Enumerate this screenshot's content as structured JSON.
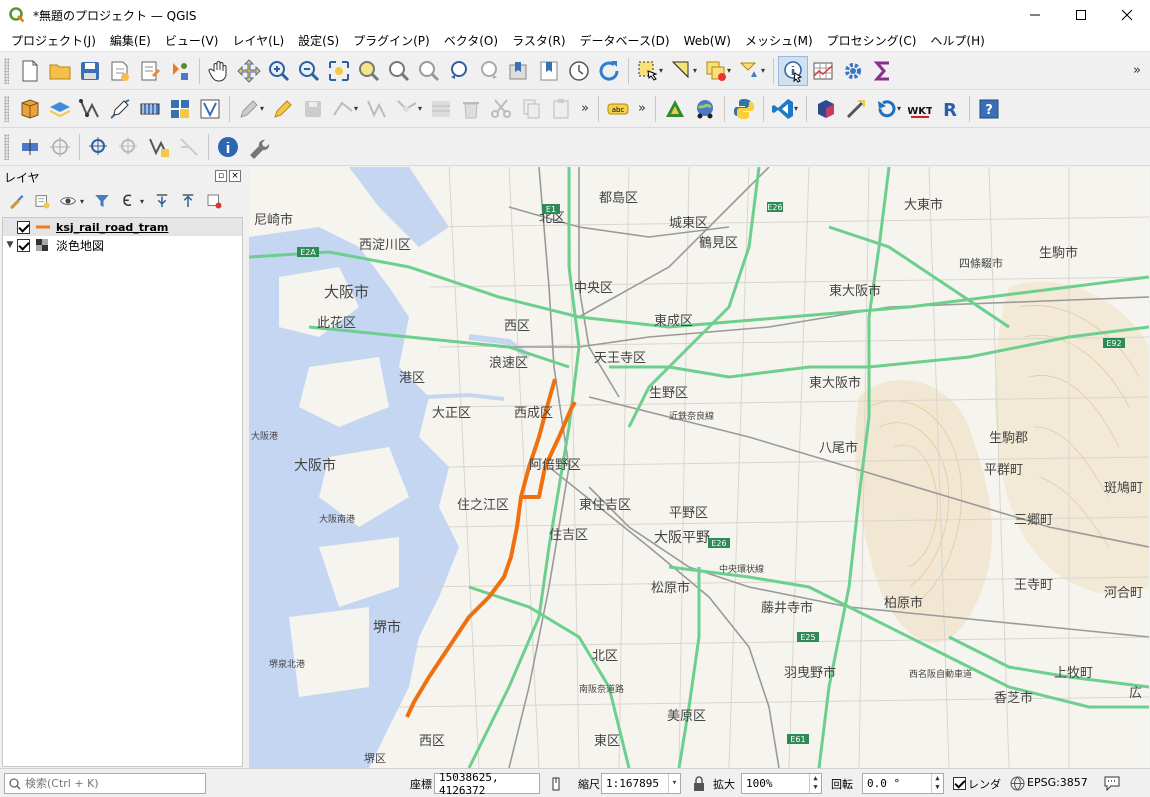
{
  "window": {
    "title": "*無題のプロジェクト — QGIS",
    "app_icon": "qgis-logo-icon",
    "controls": [
      "minimize-icon",
      "maximize-icon",
      "close-icon"
    ]
  },
  "menubar": {
    "items": [
      {
        "label": "プロジェクト(J)"
      },
      {
        "label": "編集(E)"
      },
      {
        "label": "ビュー(V)"
      },
      {
        "label": "レイヤ(L)"
      },
      {
        "label": "設定(S)"
      },
      {
        "label": "プラグイン(P)"
      },
      {
        "label": "ベクタ(O)"
      },
      {
        "label": "ラスタ(R)"
      },
      {
        "label": "データベース(D)"
      },
      {
        "label": "Web(W)"
      },
      {
        "label": "メッシュ(M)"
      },
      {
        "label": "プロセシング(C)"
      },
      {
        "label": "ヘルプ(H)"
      }
    ]
  },
  "toolbars": {
    "overflow_glyph": "»",
    "dropdown_glyph": "▾",
    "row1_icons": [
      "new-project-icon",
      "open-project-icon",
      "save-project-icon",
      "save-as-icon",
      "print-layout-icon",
      "style-manager-icon",
      "pan-hand-icon",
      "pan-to-selection-icon",
      "zoom-in-icon",
      "zoom-out-icon",
      "zoom-full-icon",
      "zoom-to-selection-icon",
      "zoom-to-layer-icon",
      "zoom-native-icon",
      "zoom-last-icon",
      "zoom-next-icon",
      "new-bookmark-icon",
      "show-bookmarks-icon",
      "temporal-controller-icon",
      "refresh-icon",
      "select-features-icon",
      "select-by-value-icon",
      "deselect-icon",
      "attribute-table-icon",
      "identify-icon",
      "field-calculator-icon",
      "toolbox-gear-icon",
      "statistics-sigma-icon"
    ],
    "row2_icons": [
      "data-source-manager-icon",
      "add-layer-icon",
      "add-vector-icon",
      "digitize-icon",
      "add-raster-icon",
      "add-mesh-icon",
      "add-wms-icon",
      "edit-pencil-icon",
      "toggle-edit-icon",
      "save-edits-icon",
      "add-feature-icon",
      "vertex-tool-icon",
      "delete-feature-icon",
      "cut-icon",
      "copy-icon",
      "paste-icon",
      "label-abc-icon",
      "inkscape-icon",
      "web-globe-icon",
      "python-icon",
      "vscode-icon",
      "plugin-3d-icon",
      "network-icon",
      "undo-icon",
      "wkt-icon",
      "r-icon",
      "help-icon"
    ],
    "row2_label_text": "abc",
    "row2_wkt_text": "WKT",
    "row2_r_text": "R",
    "row2_help_text": "?",
    "row3_icons": [
      "georeference-icon",
      "crosshair-icon",
      "coordinate-capture-icon",
      "vertex-add-icon",
      "gps-icon",
      "info-icon",
      "wrench-icon"
    ]
  },
  "layers_panel": {
    "title": "レイヤ",
    "tool_icons": [
      "style-brush-icon",
      "add-group-icon",
      "manage-visibility-eye-icon",
      "filter-legend-icon",
      "expression-filter-icon",
      "expand-all-icon",
      "collapse-all-icon",
      "remove-layer-icon"
    ],
    "layers": [
      {
        "name": "ksj_rail_road_tram",
        "checked": true,
        "selected": true,
        "symbol": "line",
        "color": "#f07b1e"
      },
      {
        "name": "淡色地図",
        "checked": true,
        "selected": false,
        "symbol": "raster",
        "color": "#555555"
      }
    ]
  },
  "map": {
    "basemap": "淡色地図",
    "colors": {
      "sea": "#c5d6f2",
      "land": "#f6f4ee",
      "expressway": "#6ccf8e",
      "rail": "#9a9a9a",
      "route": "#f07010",
      "contour": "#e7c99a"
    },
    "labels": [
      {
        "text": "尼崎市",
        "big": true
      },
      {
        "text": "西淀川区",
        "big": true
      },
      {
        "text": "大阪市",
        "big": true
      },
      {
        "text": "此花区",
        "big": true
      },
      {
        "text": "港区",
        "big": true
      },
      {
        "text": "大正区",
        "big": true
      },
      {
        "text": "大阪市",
        "big": true
      },
      {
        "text": "住之江区",
        "big": true
      },
      {
        "text": "堺市",
        "big": true
      },
      {
        "text": "北区",
        "big": true
      },
      {
        "text": "都島区",
        "big": true
      },
      {
        "text": "城東区",
        "big": true
      },
      {
        "text": "鶴見区",
        "big": true
      },
      {
        "text": "中央区",
        "big": true
      },
      {
        "text": "東成区",
        "big": true
      },
      {
        "text": "天王寺区",
        "big": true
      },
      {
        "text": "浪速区",
        "big": true
      },
      {
        "text": "西成区",
        "big": true
      },
      {
        "text": "西区",
        "big": true
      },
      {
        "text": "生野区",
        "big": true
      },
      {
        "text": "東大阪市",
        "big": true
      },
      {
        "text": "東大阪市",
        "big": true
      },
      {
        "text": "大東市",
        "big": true
      },
      {
        "text": "四條畷市",
        "big": false
      },
      {
        "text": "生駒市",
        "big": true
      },
      {
        "text": "生駒郡",
        "big": true
      },
      {
        "text": "平群町",
        "big": true
      },
      {
        "text": "阿倍野区",
        "big": true
      },
      {
        "text": "東住吉区",
        "big": true
      },
      {
        "text": "住吉区",
        "big": true
      },
      {
        "text": "平野区",
        "big": true
      },
      {
        "text": "八尾市",
        "big": true
      },
      {
        "text": "大阪平野",
        "big": true
      },
      {
        "text": "松原市",
        "big": true
      },
      {
        "text": "藤井寺市",
        "big": true
      },
      {
        "text": "柏原市",
        "big": true
      },
      {
        "text": "三郷町",
        "big": true
      },
      {
        "text": "北区",
        "big": true
      },
      {
        "text": "羽曳野市",
        "big": true
      },
      {
        "text": "西区",
        "big": true
      },
      {
        "text": "東区",
        "big": true
      },
      {
        "text": "美原区",
        "big": true
      },
      {
        "text": "堺区",
        "big": false
      },
      {
        "text": "斑鳩町",
        "big": true
      },
      {
        "text": "王寺町",
        "big": true
      },
      {
        "text": "河合町",
        "big": true
      },
      {
        "text": "上牧町",
        "big": true
      },
      {
        "text": "香芝市",
        "big": true
      },
      {
        "text": "広",
        "big": true
      },
      {
        "text": "大阪港",
        "big": false
      },
      {
        "text": "大阪南港",
        "big": false
      },
      {
        "text": "堺泉北港",
        "big": false
      },
      {
        "text": "近鉄奈良線",
        "big": false
      },
      {
        "text": "南阪奈道路",
        "big": false
      },
      {
        "text": "西名阪自動車道",
        "big": false
      },
      {
        "text": "中央環状線",
        "big": false
      },
      {
        "text": "E1",
        "big": false
      },
      {
        "text": "E26",
        "big": false
      },
      {
        "text": "E25",
        "big": false
      },
      {
        "text": "E92",
        "big": false
      },
      {
        "text": "E61",
        "big": false
      },
      {
        "text": "E2A",
        "big": false
      }
    ]
  },
  "statusbar": {
    "search_placeholder": "検索(Ctrl + K)",
    "coordinate_label": "座標",
    "coordinate_value": "15038625, 4126372",
    "scale_label": "縮尺",
    "scale_value": "1:167895",
    "magnifier_label": "拡大",
    "magnifier_value": "100%",
    "rotation_label": "回転",
    "rotation_value": "0.0 °",
    "render_label": "レンダ",
    "render_checked": true,
    "crs_value": "EPSG:3857",
    "message_icon": "messages-icon"
  }
}
